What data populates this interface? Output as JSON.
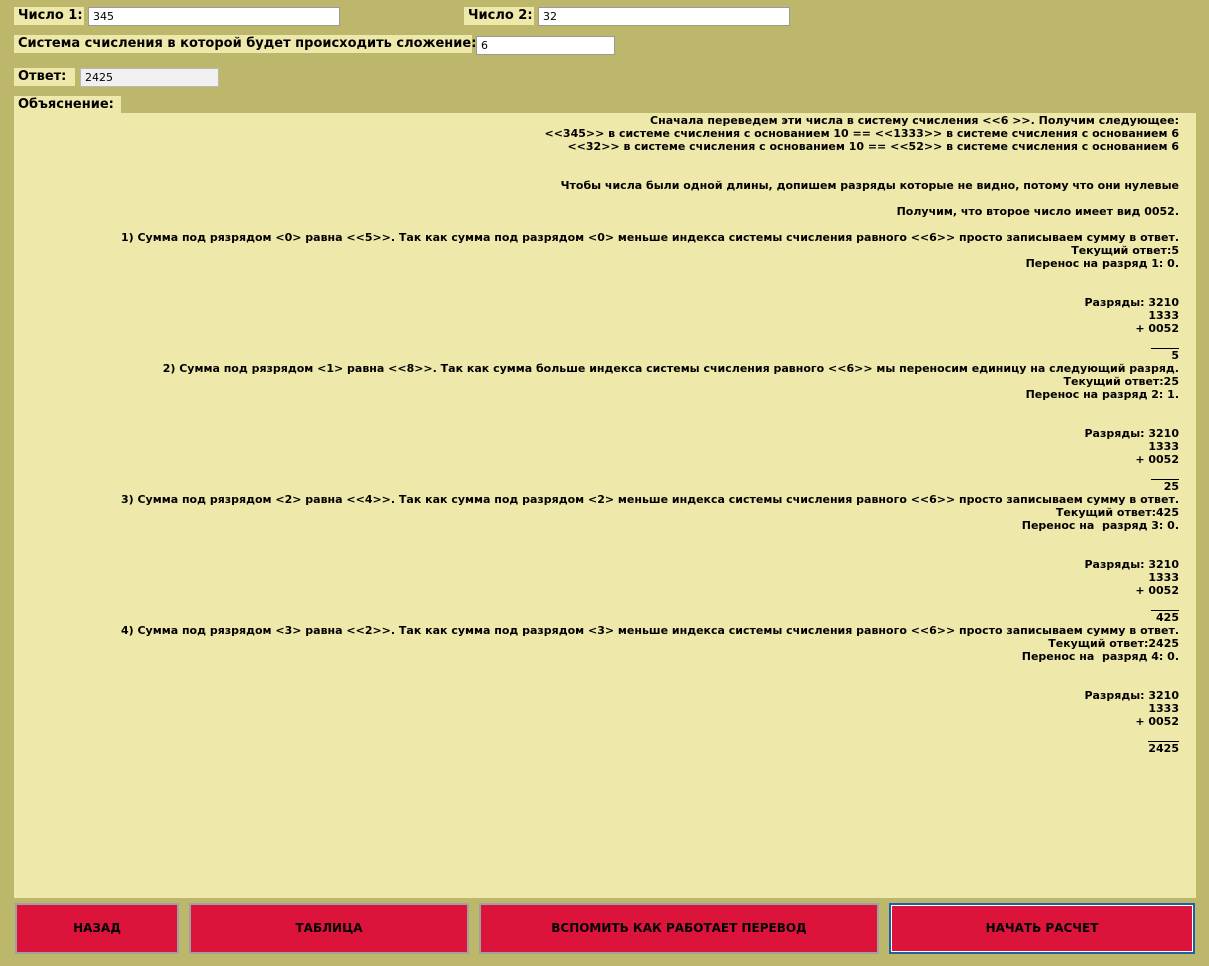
{
  "number1": {
    "label": "Число 1:",
    "value": "345"
  },
  "number2": {
    "label": "Число 2:",
    "value": "32"
  },
  "base": {
    "label": "Система счисления в которой будет происходить сложение:",
    "value": "6"
  },
  "answer": {
    "label": "Ответ:",
    "value": "2425"
  },
  "explanation": {
    "label": "Объяснение:",
    "lines": [
      "Сначала переведем эти числа в систему счисления <<6 >>. Получим следующее:",
      "<<345>> в системе счисления с основанием 10 == <<1333>> в системе счисления с основанием 6",
      "<<32>> в системе счисления с основанием 10 == <<52>> в системе счисления с основанием 6",
      "",
      "",
      "Чтобы числа были одной длины, допишем разряды которые не видно, потому что они нулевые",
      "",
      "Получим, что второе число имеет вид 0052.",
      "",
      "1) Сумма под рязрядом <0> равна <<5>>. Так как сумма под разрядом <0> меньше индекса системы счисления равного <<6>> просто записываем сумму в ответ.",
      "Текущий ответ:5",
      "Перенос на разряд 1: 0.",
      "",
      "",
      "Разряды: 3210",
      "1333",
      "+ 0052",
      "",
      "5",
      "2) Сумма под рязрядом <1> равна <<8>>. Так как сумма больше индекса системы счисления равного <<6>> мы переносим единицу на следующий разряд.",
      "Текущий ответ:25",
      "Перенос на разряд 2: 1.",
      "",
      "",
      "Разряды: 3210",
      "1333",
      "+ 0052",
      "",
      "25",
      "3) Сумма под рязрядом <2> равна <<4>>. Так как сумма под разрядом <2> меньше индекса системы счисления равного <<6>> просто записываем сумму в ответ.",
      "Текущий ответ:425",
      "Перенос на  разряд 3: 0.",
      "",
      "",
      "Разряды: 3210",
      "1333",
      "+ 0052",
      "",
      "425",
      "4) Сумма под рязрядом <3> равна <<2>>. Так как сумма под разрядом <3> меньше индекса системы счисления равного <<6>> просто записываем сумму в ответ.",
      "Текущий ответ:2425",
      "Перенос на  разряд 4: 0.",
      "",
      "",
      "Разряды: 3210",
      "1333",
      "+ 0052",
      "",
      "2425"
    ]
  },
  "buttons": {
    "back": "НАЗАД",
    "table": "ТАБЛИЦА",
    "remember": "ВСПОМИТЬ КАК РАБОТАЕТ ПЕРЕВОД",
    "start": "НАЧАТЬ РАСЧЕТ"
  },
  "colors": {
    "background": "#bdb76b",
    "panel": "#eee8aa",
    "button": "#dc143c"
  }
}
